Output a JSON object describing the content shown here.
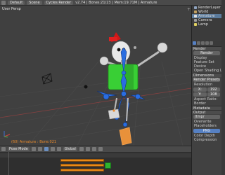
{
  "header": {
    "menu_icon": "blender-menu-icon",
    "layout": "Default",
    "scene": "Scene",
    "engine": "Cycles Render",
    "stats": "v2.74 | Bones:21/23 | Mem:19.71M | Armature"
  },
  "viewport": {
    "view_label": "User Persp",
    "status_label": "(60) Armature : Bone.021"
  },
  "vp_header": {
    "mode": "Pose Mode",
    "global": "Global"
  },
  "outliner": {
    "items": [
      {
        "label": "RenderLayer",
        "icon": "render-layer-icon"
      },
      {
        "label": "World",
        "icon": "world-icon"
      },
      {
        "label": "Armature",
        "icon": "armature-icon"
      },
      {
        "label": "Camera",
        "icon": "camera-icon"
      },
      {
        "label": "Lamp",
        "icon": "lamp-icon"
      }
    ]
  },
  "props": {
    "render_head": "Render",
    "render_btn": "Render",
    "display": "Display",
    "feature_set": "Feature Set",
    "device": "Device",
    "open_shading": "Open Shading Lan",
    "dimensions_head": "Dimensions",
    "render_presets": "Render Presets",
    "resolution": "Resolution",
    "res_x": "X:",
    "res_x_val": "192",
    "res_y": "Y:",
    "res_y_val": "108",
    "aspect": "Aspect Ratio:",
    "border": "Border",
    "metadata_head": "Metadata",
    "output_head": "Output",
    "output_path": "/tmp/",
    "overwrite": "Overwrite",
    "placeholders": "Placeholders",
    "format": "PNG",
    "color": "Color Depth",
    "compression": "Compression"
  },
  "colors": {
    "accent": "#5680c2",
    "orange": "#e88a18",
    "green": "#3bd13b",
    "blue": "#2a6de0"
  }
}
